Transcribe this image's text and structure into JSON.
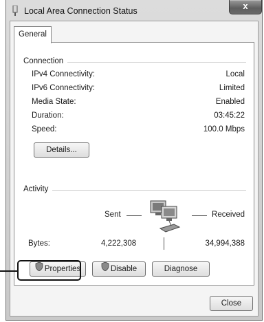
{
  "window": {
    "title": "Local Area Connection Status",
    "close_label": "x"
  },
  "tabs": [
    {
      "label": "General",
      "selected": true
    }
  ],
  "connection": {
    "heading": "Connection",
    "rows": [
      {
        "label": "IPv4 Connectivity:",
        "value": "Local"
      },
      {
        "label": "IPv6 Connectivity:",
        "value": "Limited"
      },
      {
        "label": "Media State:",
        "value": "Enabled"
      },
      {
        "label": "Duration:",
        "value": "03:45:22"
      },
      {
        "label": "Speed:",
        "value": "100.0 Mbps"
      }
    ],
    "details_label": "Details..."
  },
  "activity": {
    "heading": "Activity",
    "sent_label": "Sent",
    "received_label": "Received",
    "bytes_label": "Bytes:",
    "bytes_sent": "4,222,308",
    "bytes_received": "34,994,388"
  },
  "actions": {
    "properties_label": "Properties",
    "disable_label": "Disable",
    "diagnose_label": "Diagnose"
  },
  "footer": {
    "close_label": "Close"
  }
}
